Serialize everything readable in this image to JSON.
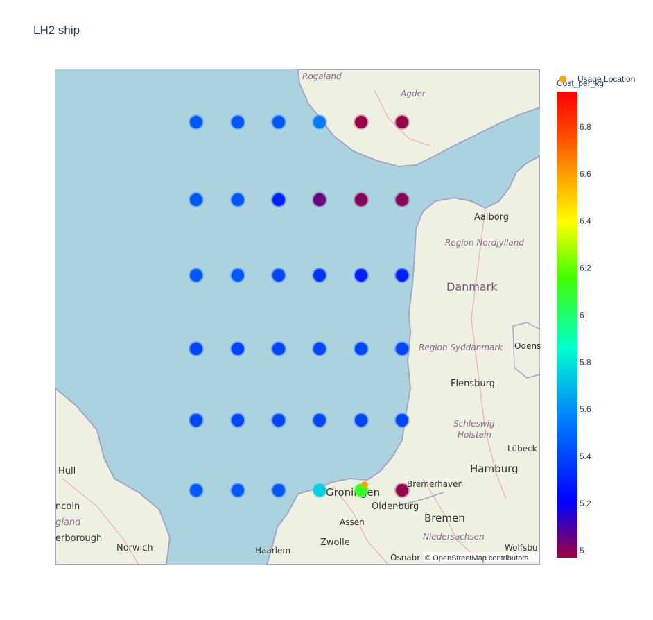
{
  "title": "LH2 ship",
  "chart_data": {
    "type": "scatter",
    "map_style": "open-street-map",
    "title": "LH2 ship",
    "colorbar": {
      "title": "Cost_per_kg",
      "ticks": [
        5,
        5.2,
        5.4,
        5.6,
        5.8,
        6,
        6.2,
        6.4,
        6.6,
        6.8
      ],
      "range": [
        4.97,
        6.95
      ],
      "colorscale": [
        "#9e0142",
        "#0000ff",
        "#0080ff",
        "#00ffcc",
        "#40ff00",
        "#ffff00",
        "#ffa000",
        "#ff5000",
        "#ff0000"
      ]
    },
    "legend": {
      "position": "top-right",
      "entries": [
        {
          "name": "Usage Location",
          "color": "#ffa500"
        }
      ]
    },
    "attribution": "© OpenStreetMap contributors",
    "map_labels": [
      "Rogaland",
      "Agder",
      "Aalborg",
      "Region Nordjylland",
      "Danmark",
      "Region Syddanmark",
      "Odens",
      "Flensburg",
      "Schleswig-",
      "Holstein",
      "Lübeck",
      "Hamburg",
      "Bremerhaven",
      "Groningen",
      "Oldenburg",
      "Bremen",
      "Niedersachsen",
      "Assen",
      "Zwolle",
      "Haarlem",
      "Osnabr",
      "Wolfsbu",
      "Hull",
      "ncoln",
      "gland",
      "erborough",
      "Norwich"
    ],
    "columns": [
      1,
      2,
      3,
      4,
      5,
      6
    ],
    "rows": [
      {
        "row": 1,
        "values": [
          5.45,
          5.45,
          5.45,
          5.55,
          4.98,
          4.98
        ]
      },
      {
        "row": 2,
        "values": [
          5.45,
          5.45,
          5.3,
          5.05,
          5.0,
          5.0
        ]
      },
      {
        "row": 3,
        "values": [
          5.45,
          5.45,
          5.4,
          5.35,
          5.3,
          5.3
        ]
      },
      {
        "row": 4,
        "values": [
          5.4,
          5.4,
          5.4,
          5.4,
          5.4,
          5.4
        ]
      },
      {
        "row": 5,
        "values": [
          5.4,
          5.4,
          5.4,
          5.4,
          5.4,
          5.4
        ]
      },
      {
        "row": 6,
        "values": [
          5.45,
          5.45,
          5.45,
          5.75,
          6.1,
          4.98
        ]
      }
    ],
    "usage_location": {
      "row": 6,
      "column": 5
    }
  }
}
